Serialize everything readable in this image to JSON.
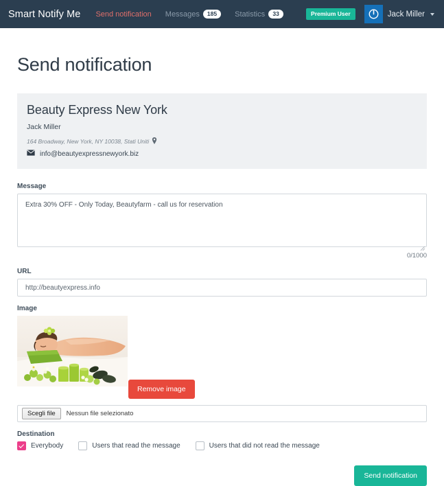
{
  "navbar": {
    "brand": "Smart Notify Me",
    "links": [
      {
        "label": "Send notification",
        "badge": "",
        "active": true
      },
      {
        "label": "Messages",
        "badge": "185",
        "active": false
      },
      {
        "label": "Statistics",
        "badge": "33",
        "active": false
      }
    ],
    "premium_label": "Premium User",
    "user_name": "Jack Miller",
    "avatar_icon": "power-icon",
    "caret_icon": "chevron-down-icon",
    "colors": {
      "background": "#2b3e50",
      "active_link": "#df6f6a",
      "premium": "#19b698",
      "avatar": "#1570b8"
    }
  },
  "page": {
    "title": "Send notification"
  },
  "business": {
    "name": "Beauty Express New York",
    "owner": "Jack Miller",
    "address": "164 Broadway, New York, NY 10038, Stati Uniti",
    "address_icon": "map-pin-icon",
    "email": "info@beautyexpressnewyork.biz",
    "email_icon": "envelope-icon"
  },
  "form": {
    "message": {
      "label": "Message",
      "value": "Extra 30% OFF - Only Today, Beautyfarm - call us for reservation",
      "placeholder": "",
      "counter": "0/1000"
    },
    "url": {
      "label": "URL",
      "value": "http://beautyexpress.info",
      "placeholder": ""
    },
    "image": {
      "label": "Image",
      "remove_label": "Remove image",
      "alt": "spa massage preview"
    },
    "file": {
      "choose_label": "Scegli file",
      "status": "Nessun file selezionato"
    },
    "destination": {
      "label": "Destination",
      "options": [
        {
          "label": "Everybody",
          "checked": true
        },
        {
          "label": "Users that read the message",
          "checked": false
        },
        {
          "label": "Users that did not read the message",
          "checked": false
        }
      ]
    },
    "submit_label": "Send notification"
  },
  "colors": {
    "remove_button": "#e8493c",
    "send_button": "#19b698",
    "checkbox_checked": "#ec3e8a",
    "panel_bg": "#eff1f3"
  }
}
